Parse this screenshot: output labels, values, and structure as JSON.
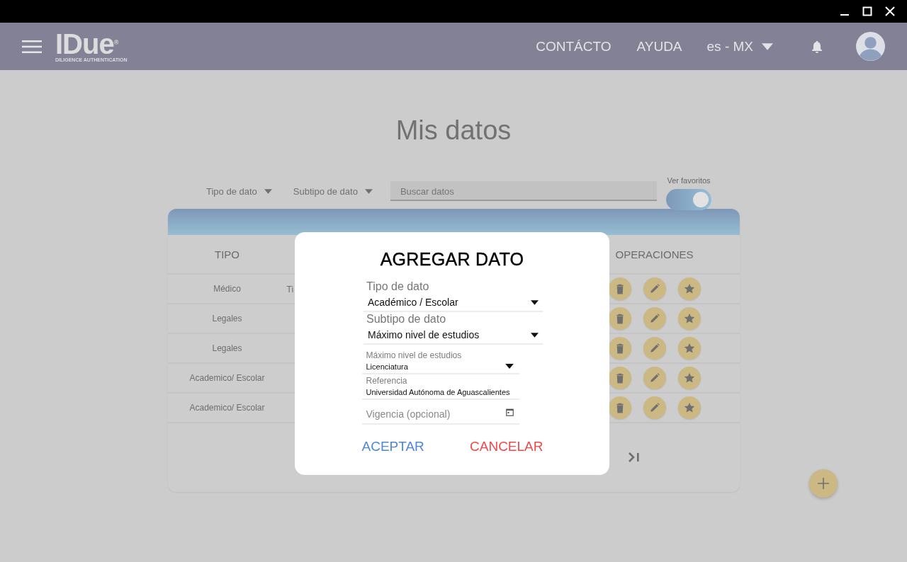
{
  "header": {
    "brand": "IDue$^{®}$",
    "tagline": "DILIGENCE AUTHENTICATION",
    "nav": [
      "CONTÁCTO",
      "AYUDA"
    ],
    "language": "es - MX"
  },
  "page_title": "Mis datos",
  "filters": [
    {
      "label": "Tipo de dato"
    },
    {
      "label": "Subtipo de dato"
    }
  ],
  "search": {
    "placeholder": "Buscar datos"
  },
  "favorites_toggle": {
    "label": "Ver favoritos",
    "on": true
  },
  "table": {
    "columns": [
      {
        "heading": "TIPO"
      },
      {
        "heading": "OPERACIONES"
      }
    ],
    "rows": [
      {
        "tipo": "Médico",
        "column_2": "Ti"
      },
      {
        "tipo": "Legales"
      },
      {
        "tipo": "Legales"
      },
      {
        "tipo": "Academico/ Escolar"
      },
      {
        "tipo": "Academico/ Escolar"
      }
    ]
  },
  "modal": {
    "title": "AGREGAR DATO",
    "fields": [
      {
        "kind": "select",
        "label": "Tipo de dato",
        "value": "Académico / Escolar"
      },
      {
        "kind": "select",
        "label": "Subtipo de dato",
        "value": "Máximo nivel de estudios"
      }
    ],
    "subfields": [
      {
        "kind": "select",
        "label": "Máximo nivel de estudios",
        "value": "Licenciatura"
      },
      {
        "kind": "text",
        "label": "Referencia",
        "value": "Universidad Autónoma de Aguascalientes"
      },
      {
        "kind": "date",
        "placeholder": "Vigencia (opcional)"
      }
    ],
    "buttons": [
      {
        "kind": "accept",
        "label": "ACEPTAR"
      },
      {
        "kind": "cancel",
        "label": "CANCELAR"
      }
    ]
  }
}
